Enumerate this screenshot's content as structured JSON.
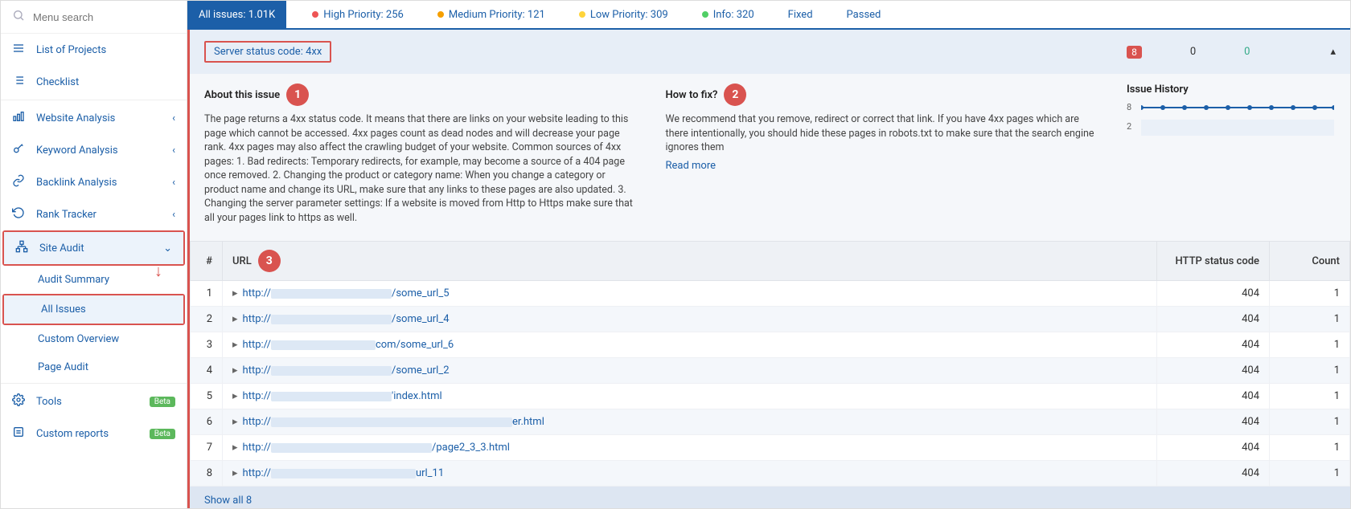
{
  "search": {
    "placeholder": "Menu search"
  },
  "sidebar": {
    "list_of_projects": "List of Projects",
    "checklist": "Checklist",
    "website_analysis": "Website Analysis",
    "keyword_analysis": "Keyword Analysis",
    "backlink_analysis": "Backlink Analysis",
    "rank_tracker": "Rank Tracker",
    "site_audit": "Site Audit",
    "audit_summary": "Audit Summary",
    "all_issues": "All Issues",
    "custom_overview": "Custom Overview",
    "page_audit": "Page Audit",
    "tools": "Tools",
    "custom_reports": "Custom reports",
    "beta": "Beta"
  },
  "tabs": {
    "all_issues": "All issues: 1.01K",
    "high": "High Priority: 256",
    "medium": "Medium Priority: 121",
    "low": "Low Priority: 309",
    "info": "Info: 320",
    "fixed": "Fixed",
    "passed": "Passed"
  },
  "issue": {
    "title": "Server status code: 4xx",
    "stat_red": "8",
    "stat_zero": "0",
    "stat_green": "0"
  },
  "about": {
    "heading": "About this issue",
    "num": "1",
    "text": "The page returns a 4xx status code. It means that there are links on your website leading to this page which cannot be accessed. 4xx pages count as dead nodes and will decrease your page rank. 4xx pages may also affect the crawling budget of your website. Common sources of 4xx pages: 1. Bad redirects: Temporary redirects, for example, may become a source of a 404 page once removed. 2. Changing the product or category name: When you change a category or product name and change its URL, make sure that any links to these pages are also updated. 3. Changing the server parameter settings: If a website is moved from Http to Https make sure that all your pages link to https as well."
  },
  "howto": {
    "heading": "How to fix?",
    "num": "2",
    "text": "We recommend that you remove, redirect or correct that link. If you have 4xx pages which are there intentionally, you should hide these pages in robots.txt to make sure that the search engine ignores them",
    "read_more": "Read more"
  },
  "history": {
    "heading": "Issue History",
    "y1": "8",
    "y2": "2"
  },
  "table": {
    "col_num": "#",
    "col_url": "URL",
    "col_http": "HTTP status code",
    "col_count": "Count",
    "url_num": "3",
    "rows": [
      {
        "n": "1",
        "prefix": "http://",
        "suffix": "/some_url_5",
        "blur": 150,
        "http": "404",
        "count": "1"
      },
      {
        "n": "2",
        "prefix": "http://",
        "suffix": "/some_url_4",
        "blur": 150,
        "http": "404",
        "count": "1"
      },
      {
        "n": "3",
        "prefix": "http://",
        "suffix": "com/some_url_6",
        "blur": 130,
        "http": "404",
        "count": "1"
      },
      {
        "n": "4",
        "prefix": "http://",
        "suffix": "/some_url_2",
        "blur": 150,
        "http": "404",
        "count": "1"
      },
      {
        "n": "5",
        "prefix": "http://",
        "suffix": "'index.html",
        "blur": 150,
        "http": "404",
        "count": "1"
      },
      {
        "n": "6",
        "prefix": "http://",
        "suffix": "er.html",
        "blur": 300,
        "http": "404",
        "count": "1"
      },
      {
        "n": "7",
        "prefix": "http://",
        "suffix": "/page2_3_3.html",
        "blur": 200,
        "http": "404",
        "count": "1"
      },
      {
        "n": "8",
        "prefix": "http://",
        "suffix": "url_11",
        "blur": 180,
        "http": "404",
        "count": "1"
      }
    ],
    "show_all": "Show all 8"
  },
  "chart_data": {
    "type": "line",
    "title": "Issue History",
    "x": [
      1,
      2,
      3,
      4,
      5,
      6,
      7,
      8,
      9,
      10
    ],
    "values": [
      8,
      8,
      8,
      8,
      8,
      8,
      8,
      8,
      8,
      8
    ],
    "ylabel": "",
    "ylim": [
      2,
      8
    ]
  }
}
